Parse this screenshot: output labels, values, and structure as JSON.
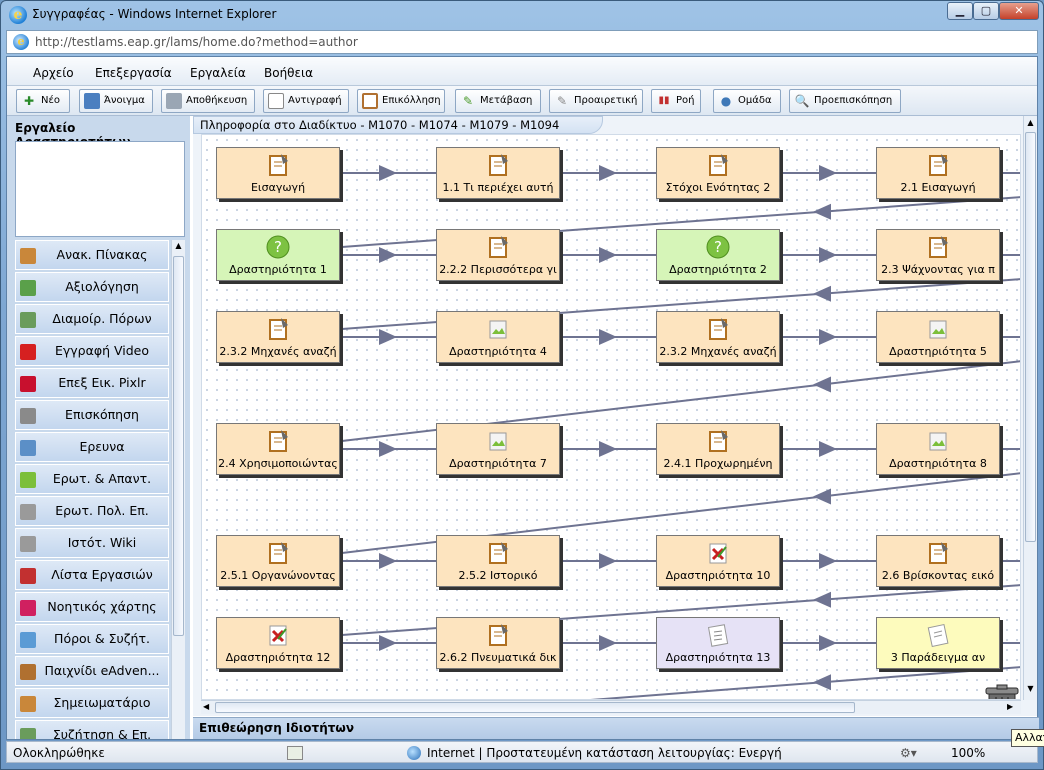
{
  "window": {
    "title": "Συγγραφέας - Windows Internet Explorer",
    "url": "http://testlams.eap.gr/lams/home.do?method=author"
  },
  "menu": [
    "Αρχείο",
    "Επεξεργασία",
    "Εργαλεία",
    "Βοήθεια"
  ],
  "toolbar": [
    {
      "label": "Νέο",
      "icon": "new-icon"
    },
    {
      "label": "Άνοιγμα",
      "icon": "open-folder-icon"
    },
    {
      "label": "Αποθήκευση",
      "icon": "save-icon"
    },
    {
      "label": "Αντιγραφή",
      "icon": "copy-icon"
    },
    {
      "label": "Επικόλληση",
      "icon": "paste-icon"
    },
    {
      "label": "Μετάβαση",
      "icon": "transition-icon"
    },
    {
      "label": "Προαιρετική",
      "icon": "optional-icon"
    },
    {
      "label": "Ροή",
      "icon": "flow-icon"
    },
    {
      "label": "Ομάδα",
      "icon": "group-icon"
    },
    {
      "label": "Προεπισκόπηση",
      "icon": "preview-icon"
    }
  ],
  "left_panel": {
    "title": "Εργαλείο Δραστηριοτήτων",
    "tools": [
      {
        "label": "Ανακ. Πίνακας",
        "icon": "noticeboard-icon",
        "color": "#c9873a"
      },
      {
        "label": "Αξιολόγηση",
        "icon": "assessment-icon",
        "color": "#5aa04a"
      },
      {
        "label": "Διαμοίρ. Πόρων",
        "icon": "share-resources-icon",
        "color": "#6a9c5c"
      },
      {
        "label": "Εγγραφή Video",
        "icon": "video-record-icon",
        "color": "#d62020"
      },
      {
        "label": "Επεξ Εικ. Pixlr",
        "icon": "pixlr-icon",
        "color": "#c8102e"
      },
      {
        "label": "Επισκόπηση",
        "icon": "review-icon",
        "color": "#8a8a8a"
      },
      {
        "label": "Ερευνα",
        "icon": "survey-icon",
        "color": "#5b8fc7"
      },
      {
        "label": "Ερωτ. & Απαντ.",
        "icon": "qa-icon",
        "color": "#7cbf3a"
      },
      {
        "label": "Ερωτ. Πολ. Επ.",
        "icon": "mcq-icon",
        "color": "#9a9a9a"
      },
      {
        "label": "Ιστότ. Wiki",
        "icon": "wiki-icon",
        "color": "#9a9a9a"
      },
      {
        "label": "Λίστα Εργασιών",
        "icon": "task-list-icon",
        "color": "#c23030"
      },
      {
        "label": "Νοητικός χάρτης",
        "icon": "mindmap-icon",
        "color": "#d02060"
      },
      {
        "label": "Πόροι & Συζήτ.",
        "icon": "resources-forum-icon",
        "color": "#5b9bd5"
      },
      {
        "label": "Παιχνίδι eAdven...",
        "icon": "eadventure-icon",
        "color": "#b07030"
      },
      {
        "label": "Σημειωματάριο",
        "icon": "notebook-icon",
        "color": "#c9873a"
      },
      {
        "label": "Συζήτηση & Επ.",
        "icon": "forum-icon",
        "color": "#6a9c5c"
      }
    ]
  },
  "canvas": {
    "tab_title": "Πληροφορία στο Διαδίκτυο - M1070 - M1074 - M1079 - M1094",
    "nodes": [
      {
        "label": "Εισαγωγή",
        "kind": "notebook",
        "color": "#fde4bf"
      },
      {
        "label": "1.1 Τι περιέχει αυτή",
        "kind": "notebook",
        "color": "#fde4bf"
      },
      {
        "label": "Στόχοι Ενότητας 2",
        "kind": "notebook",
        "color": "#fde4bf"
      },
      {
        "label": "2.1 Εισαγωγή",
        "kind": "notebook",
        "color": "#fde4bf"
      },
      {
        "label": "Δραστηριότητα 1",
        "kind": "question",
        "color": "#d6f5b8"
      },
      {
        "label": "2.2.2 Περισσότερα γι",
        "kind": "notebook",
        "color": "#fde4bf"
      },
      {
        "label": "Δραστηριότητα 2",
        "kind": "question",
        "color": "#d6f5b8"
      },
      {
        "label": "2.3 Ψάχνοντας για π",
        "kind": "notebook",
        "color": "#fde4bf"
      },
      {
        "label": "2.3.2 Μηχανές αναζή",
        "kind": "notebook",
        "color": "#fde4bf"
      },
      {
        "label": "Δραστηριότητα 4",
        "kind": "image",
        "color": "#fde4bf"
      },
      {
        "label": "2.3.2 Μηχανές αναζή",
        "kind": "notebook",
        "color": "#fde4bf"
      },
      {
        "label": "Δραστηριότητα 5",
        "kind": "image",
        "color": "#fde4bf"
      },
      {
        "label": "2.4 Χρησιμοποιώντας",
        "kind": "notebook",
        "color": "#fde4bf"
      },
      {
        "label": "Δραστηριότητα 7",
        "kind": "image",
        "color": "#fde4bf"
      },
      {
        "label": "2.4.1 Προχωρημένη",
        "kind": "notebook",
        "color": "#fde4bf"
      },
      {
        "label": "Δραστηριότητα 8",
        "kind": "image",
        "color": "#fde4bf"
      },
      {
        "label": "2.5.1 Οργανώνοντας",
        "kind": "notebook",
        "color": "#fde4bf"
      },
      {
        "label": "2.5.2 Ιστορικό",
        "kind": "notebook",
        "color": "#fde4bf"
      },
      {
        "label": "Δραστηριότητα 10",
        "kind": "tasklist",
        "color": "#fde4bf"
      },
      {
        "label": "2.6 Βρίσκοντας εικό",
        "kind": "notebook",
        "color": "#fde4bf"
      },
      {
        "label": "Δραστηριότητα 12",
        "kind": "tasklist",
        "color": "#fde4bf"
      },
      {
        "label": "2.6.2 Πνευματικά δικ",
        "kind": "notebook",
        "color": "#fde4bf"
      },
      {
        "label": "Δραστηριότητα 13",
        "kind": "list",
        "color": "#e6e2f6"
      },
      {
        "label": "3 Παράδειγμα αν",
        "kind": "review",
        "color": "#fdfbbd"
      }
    ]
  },
  "properties_bar": "Επιθεώρηση Ιδιοτήτων",
  "status": {
    "left": "Ολοκληρώθηκε",
    "zone": "Internet | Προστατευμένη κατάσταση λειτουργίας: Ενεργή",
    "zoom": "100%"
  },
  "tooltip": "Αλλαγ"
}
